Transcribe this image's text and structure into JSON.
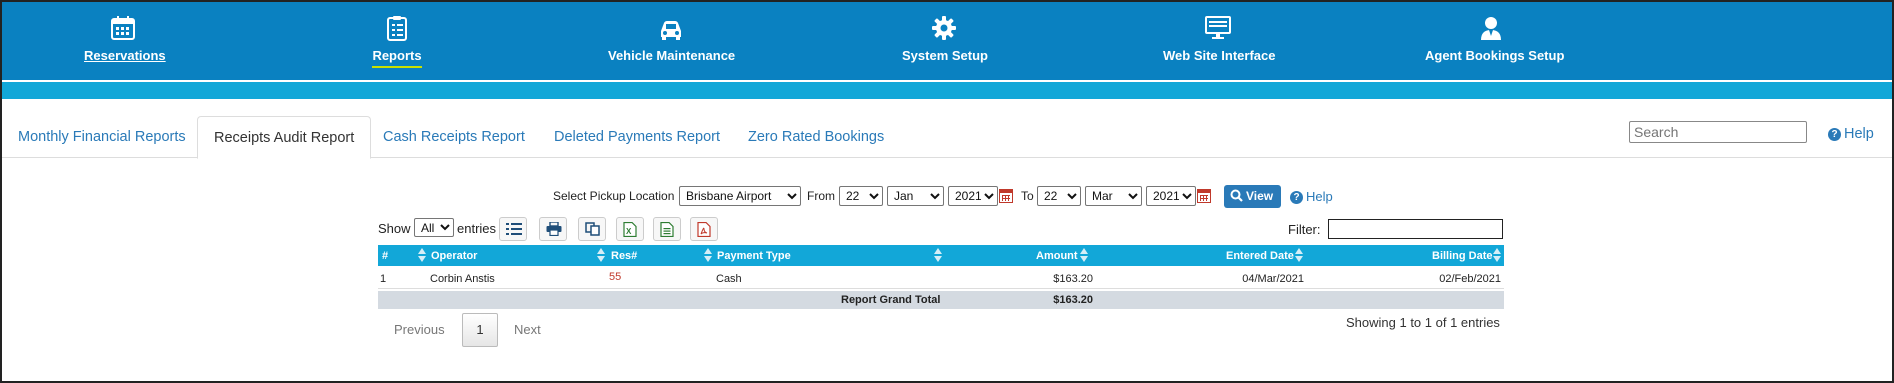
{
  "nav": {
    "items": [
      {
        "label": "Reservations",
        "icon": "calendar-icon"
      },
      {
        "label": "Reports",
        "icon": "clipboard-list-icon"
      },
      {
        "label": "Vehicle Maintenance",
        "icon": "car-icon"
      },
      {
        "label": "System Setup",
        "icon": "gear-icon"
      },
      {
        "label": "Web Site Interface",
        "icon": "monitor-icon"
      },
      {
        "label": "Agent Bookings Setup",
        "icon": "agent-user-icon"
      }
    ],
    "active": "Reports"
  },
  "tabs": [
    {
      "label": "Monthly Financial Reports"
    },
    {
      "label": "Receipts Audit Report"
    },
    {
      "label": "Cash Receipts Report"
    },
    {
      "label": "Deleted Payments Report"
    },
    {
      "label": "Zero Rated Bookings"
    }
  ],
  "active_tab": "Receipts Audit Report",
  "search": {
    "placeholder": "Search",
    "value": ""
  },
  "help_label": "Help",
  "filters": {
    "location_label": "Select Pickup Location",
    "location_value": "Brisbane Airport",
    "from_label": "From",
    "from_day": "22",
    "from_month": "Jan",
    "from_year": "2021",
    "to_label": "To",
    "to_day": "22",
    "to_month": "Mar",
    "to_year": "2021",
    "view_label": "View",
    "help_label": "Help"
  },
  "toolbar": {
    "show_label": "Show",
    "show_value": "All",
    "entries_label": "entries",
    "buttons": [
      "column-list-icon",
      "print-icon",
      "copy-icon",
      "excel-icon",
      "csv-icon",
      "pdf-icon"
    ],
    "filter_label": "Filter:",
    "filter_value": ""
  },
  "table": {
    "headers": [
      "#",
      "Operator",
      "Res#",
      "Payment Type",
      "Amount",
      "Entered Date",
      "Billing Date"
    ],
    "rows": [
      {
        "num": "1",
        "operator": "Corbin Anstis",
        "res": "55",
        "payment_type": "Cash",
        "amount": "$163.20",
        "entered_date": "04/Mar/2021",
        "billing_date": "02/Feb/2021"
      }
    ],
    "total_label": "Report Grand Total",
    "total_amount": "$163.20"
  },
  "pagination": {
    "prev_label": "Previous",
    "current_page": "1",
    "next_label": "Next",
    "info": "Showing 1 to 1 of 1 entries"
  },
  "colors": {
    "nav_bg": "#0a81c1",
    "sub_bar": "#12a7d8",
    "table_header": "#12a7d8",
    "link": "#2a7ab8",
    "res_link": "#c0392b",
    "active_underline": "#c8e000"
  }
}
